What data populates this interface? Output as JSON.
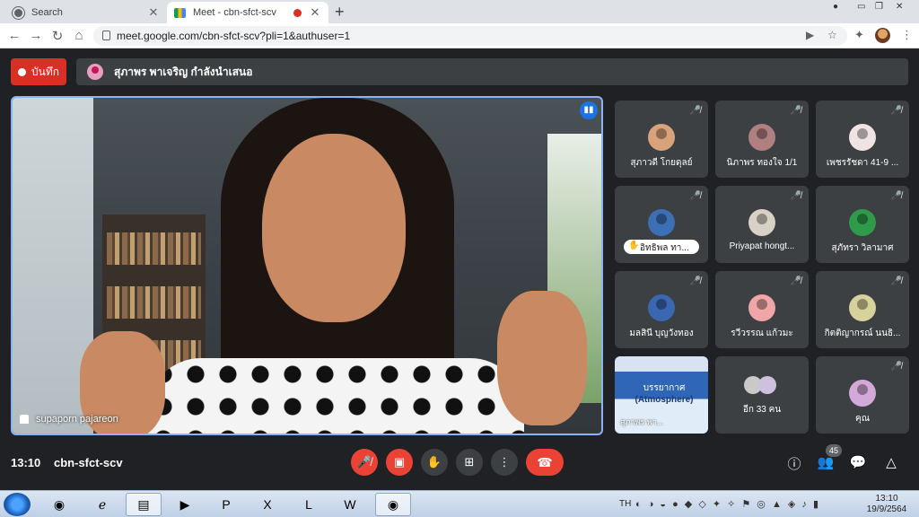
{
  "browser": {
    "tabs": [
      {
        "title": "Search",
        "icon": "globe-icon"
      },
      {
        "title": "Meet - cbn-sfct-scv",
        "icon": "meet-icon",
        "recording": true
      }
    ],
    "url": "meet.google.com/cbn-sfct-scv?pli=1&authuser=1"
  },
  "meet": {
    "record_label": "บันทึก",
    "presenter_banner": "สุภาพร พาเจริญ กำลังนำเสนอ",
    "main_speaker": "supaporn pajareon",
    "participants": [
      {
        "name": "สุภาวดี โกยดุลย์",
        "muted": true,
        "color": "#d9a27a"
      },
      {
        "name": "นิภาพร ทองใจ 1/1",
        "muted": true,
        "color": "#b07f7f"
      },
      {
        "name": "เพชรรัชดา 41-9 ...",
        "muted": true,
        "color": "#efe3e3"
      },
      {
        "name": "อิทธิพล ทา...",
        "muted": true,
        "hand": true,
        "color": "#3d6fb5"
      },
      {
        "name": "Priyapat hongt...",
        "muted": true,
        "color": "#d8d2c4"
      },
      {
        "name": "สุภัทรา วิลามาศ",
        "muted": true,
        "color": "#2e9a4a"
      },
      {
        "name": "มลสินี บุญวังทอง",
        "muted": true,
        "color": "#3a67b0"
      },
      {
        "name": "รวีวรรณ แก้วมะ",
        "muted": true,
        "color": "#f0a6a6"
      },
      {
        "name": "กิตติญากรณ์ นนธิ...",
        "muted": true,
        "color": "#d7d19c"
      }
    ],
    "presentation_tile": {
      "title": "บรรยากาศ",
      "subtitle": "(Atmosphere)",
      "name": "สุภาพร พา..."
    },
    "more_tile": "อีก 33 คน",
    "self_tile": {
      "name": "คุณ",
      "muted": true,
      "color": "#d2a9d8"
    },
    "time": "13:10",
    "meeting_code": "cbn-sfct-scv",
    "people_count": "45"
  },
  "taskbar": {
    "lang": "TH",
    "time": "13:10",
    "date": "19/9/2564"
  }
}
